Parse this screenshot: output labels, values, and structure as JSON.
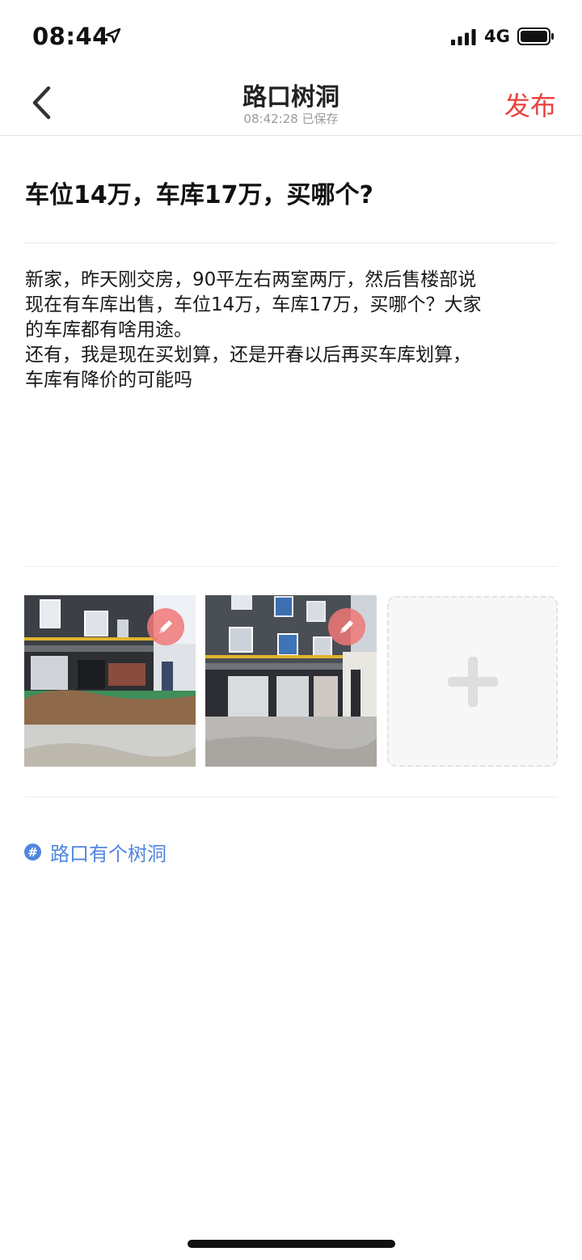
{
  "status_bar": {
    "time": "08:44",
    "network": "4G",
    "icons": [
      "location-arrow-icon",
      "signal-bars-icon",
      "battery-icon"
    ]
  },
  "nav": {
    "title": "路口树洞",
    "saved_status": "08:42:28 已保存",
    "publish_label": "发布",
    "publish_color": "#e8423f",
    "back_icon": "chevron-left-icon"
  },
  "post": {
    "title": "车位14万，车库17万，买哪个?",
    "body_lines": [
      "新家，昨天刚交房，90平左右两室两厅，然后售楼部说",
      "现在有车库出售，车位14万，车库17万，买哪个？大家",
      "的车库都有啥用途。",
      "还有，我是现在买划算，还是开春以后再买车库划算，",
      "车库有降价的可能吗"
    ]
  },
  "photos": {
    "items": [
      {
        "edit_icon": "pencil-icon"
      },
      {
        "edit_icon": "pencil-icon"
      }
    ],
    "add_icon": "plus-icon"
  },
  "topic": {
    "icon_glyph": "#",
    "label": "路口有个树洞",
    "color": "#4f86e0"
  }
}
